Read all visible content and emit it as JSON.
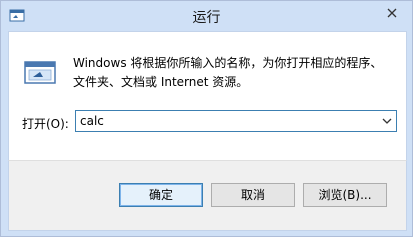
{
  "window": {
    "title": "运行",
    "icon": "run-app-icon",
    "close_icon": "close-icon"
  },
  "content": {
    "description_line1": "Windows 将根据你所输入的名称，为你打开相应的程序、",
    "description_line2": "文件夹、文档或 Internet 资源。",
    "open_label": "打开(O):",
    "input_value": "calc",
    "dropdown_icon": "chevron-down-icon"
  },
  "buttons": {
    "ok_label": "确定",
    "cancel_label": "取消",
    "browse_label": "浏览(B)..."
  },
  "colors": {
    "titlebar": "#cfe0f6",
    "client_background": "#ffffff",
    "footer_background": "#f0f0f0",
    "focus_border": "#3c7fb1"
  }
}
